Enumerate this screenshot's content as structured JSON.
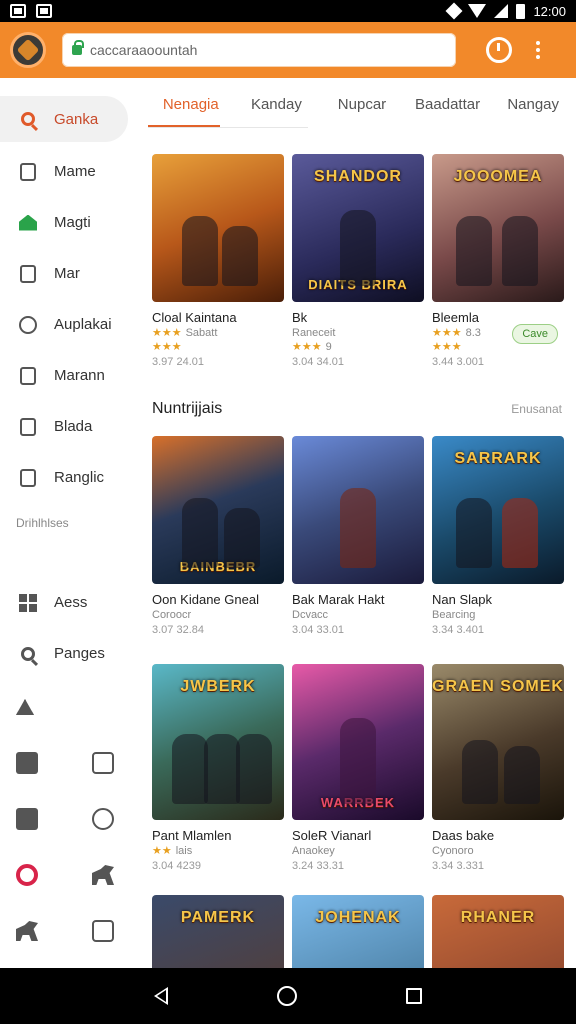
{
  "statusbar": {
    "time": "12:00"
  },
  "appbar": {
    "search_text": "caccaraaoountah"
  },
  "sidebar": {
    "items": [
      {
        "label": "Ganka",
        "icon": "search-icon",
        "active": true
      },
      {
        "label": "Mame",
        "icon": "document-icon"
      },
      {
        "label": "Magti",
        "icon": "home-icon"
      },
      {
        "label": "Mar",
        "icon": "list-icon"
      },
      {
        "label": "Auplakai",
        "icon": "settings-icon"
      },
      {
        "label": "Marann",
        "icon": "message-icon"
      },
      {
        "label": "Blada",
        "icon": "tools-icon"
      },
      {
        "label": "Ranglic",
        "icon": "image-icon"
      }
    ],
    "section_label": "Drihlhlses",
    "items2": [
      {
        "label": "Aess",
        "icon": "grid-icon"
      },
      {
        "label": "Panges",
        "icon": "search-icon"
      }
    ]
  },
  "tabs": [
    "Nenagia",
    "Kanday",
    "Nupcar",
    "Baadattar",
    "Nangay"
  ],
  "row1": [
    {
      "thumb_title": "",
      "name": "Cloal Kaintana",
      "sub": "Sabatt",
      "stars": "★★★",
      "rating": "",
      "meta": "3.97  24.01",
      "color": "#b8581a"
    },
    {
      "thumb_title": "DIAITS BRIRA",
      "top_title": "SHANDOR",
      "name": "Bk",
      "sub": "Raneceit",
      "stars": "★★★",
      "rating": "9",
      "meta": "3.04  34.01",
      "color": "#3a3a6a"
    },
    {
      "thumb_title": "",
      "top_title": "JOOOMEA",
      "name": "Bleemla",
      "sub": "",
      "stars": "★★★",
      "rating": "8.3",
      "meta": "3.44  3.001",
      "color": "#8a5a5a",
      "badge": "Cave"
    }
  ],
  "section": {
    "title": "Nuntrijjais",
    "more": "Enusanat"
  },
  "row2": [
    {
      "thumb_title": "BAINBEBR",
      "name": "Oon Kidane Gneal",
      "sub": "Coroocr",
      "meta": "3.07  32.84",
      "color": "#1e3a5a"
    },
    {
      "thumb_title": "",
      "name": "Bak Marak Hakt",
      "sub": "Dcvacc",
      "meta": "3.04  33.01",
      "color": "#3a4a7a"
    },
    {
      "thumb_title": "",
      "top_title": "SARRARK",
      "name": "Nan Slapk",
      "sub": "Bearcing",
      "meta": "3.34  3.401",
      "color": "#1a4a6a"
    }
  ],
  "row3": [
    {
      "thumb_title": "",
      "top_title": "JWBERK",
      "name": "Pant Mlamlen",
      "sub": "",
      "stars": "★★",
      "rating": "lais",
      "meta": "3.04  4239",
      "color": "#3a6a5a"
    },
    {
      "thumb_title": "WARRBEK",
      "name": "SoleR Vianarl",
      "sub": "Anaokey",
      "meta": "3.24  33.31",
      "color": "#5a2a6a"
    },
    {
      "thumb_title": "",
      "top_title": "GRAEN SOMEK",
      "name": "Daas bake",
      "sub": "Cyonoro",
      "meta": "3.34  3.331",
      "color": "#4a3a2a"
    }
  ],
  "row4": [
    {
      "top_title": "PAMERK",
      "color": "#5a3a2a"
    },
    {
      "top_title": "JOHENAK",
      "color": "#3a6a8a"
    },
    {
      "top_title": "RHANER",
      "color": "#7a3a2a"
    }
  ]
}
